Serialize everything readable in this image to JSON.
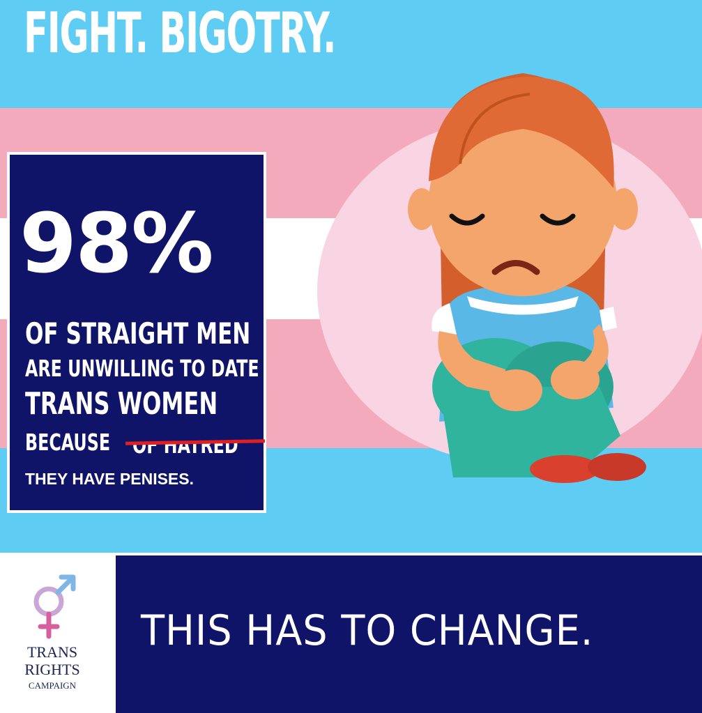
{
  "headline": "FIGHT. BIGOTRY.",
  "stat": {
    "percent": "98%",
    "line_1": "OF STRAIGHT MEN",
    "line_2": "ARE UNWILLING TO DATE",
    "line_3": "TRANS WOMEN",
    "line_4": "BECAUSE",
    "struck_text": "OF HATRED",
    "replacement": "THEY HAVE PENISES."
  },
  "illustration": {
    "subject": "sad-girl-sitting-hugging-knees"
  },
  "logo": {
    "icon": "transgender-symbol-icon",
    "line_1": "TRANS",
    "line_2": "RIGHTS",
    "line_3": "CAMPAIGN"
  },
  "footer": {
    "slogan": "THIS HAS TO CHANGE."
  },
  "colors": {
    "flag_blue": "#5fcdf3",
    "flag_pink": "#f3aabd",
    "flag_white": "#ffffff",
    "navy": "#101469",
    "strike_red": "#e02020"
  }
}
